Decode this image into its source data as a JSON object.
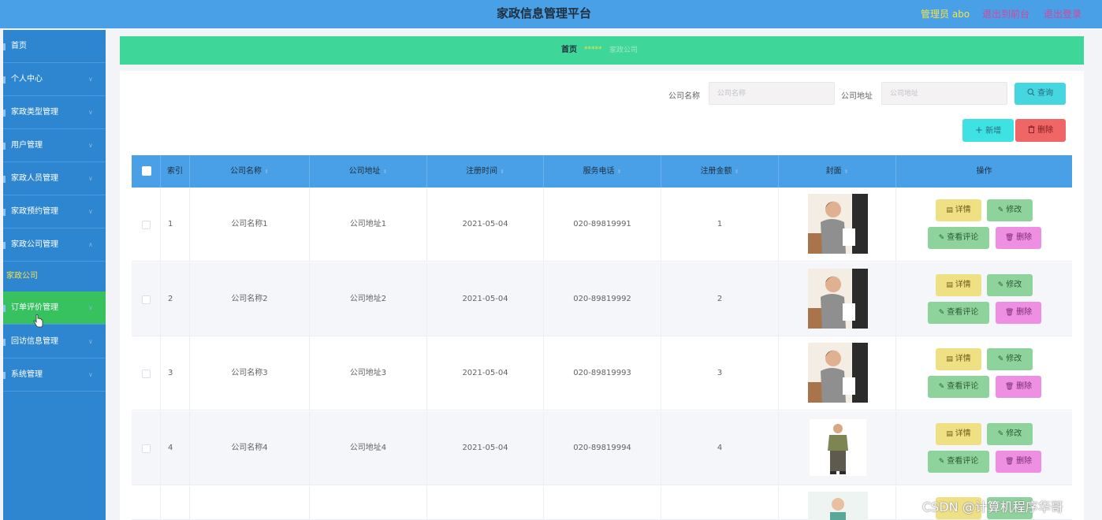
{
  "header": {
    "title": "家政信息管理平台",
    "admin": "管理员 abo",
    "front_link": "退出到前台",
    "logout_link": "退出登录"
  },
  "sidebar": {
    "items": [
      {
        "label": "首页"
      },
      {
        "label": "个人中心"
      },
      {
        "label": "家政类型管理"
      },
      {
        "label": "用户管理"
      },
      {
        "label": "家政人员管理"
      },
      {
        "label": "家政预约管理"
      },
      {
        "label": "家政公司管理"
      },
      {
        "label": "订单评价管理"
      },
      {
        "label": "回访信息管理"
      },
      {
        "label": "系统管理"
      }
    ],
    "subitem": "家政公司",
    "chevron_down": "∨",
    "chevron_up": "∧"
  },
  "breadcrumb": {
    "home": "首页",
    "separator": "*****",
    "current": "家政公司"
  },
  "search": {
    "name_label": "公司名称",
    "name_placeholder": "公司名称",
    "address_label": "公司地址",
    "address_placeholder": "公司地址",
    "query_label": "查询",
    "query_icon": "search-icon"
  },
  "toolbar": {
    "add_label": "新增",
    "delete_label": "删除"
  },
  "table": {
    "columns": [
      "索引",
      "公司名称",
      "公司地址",
      "注册时间",
      "服务电话",
      "注册金额",
      "封面",
      "操作"
    ],
    "sort_glyph": "⬍",
    "rows": [
      {
        "index": "1",
        "name": "公司名称1",
        "address": "公司地址1",
        "date": "2021-05-04",
        "phone": "020-89819991",
        "amount": "1",
        "cover": "photo-woman"
      },
      {
        "index": "2",
        "name": "公司名称2",
        "address": "公司地址2",
        "date": "2021-05-04",
        "phone": "020-89819992",
        "amount": "2",
        "cover": "photo-woman"
      },
      {
        "index": "3",
        "name": "公司名称3",
        "address": "公司地址3",
        "date": "2021-05-04",
        "phone": "020-89819993",
        "amount": "3",
        "cover": "photo-woman"
      },
      {
        "index": "4",
        "name": "公司名称4",
        "address": "公司地址4",
        "date": "2021-05-04",
        "phone": "020-89819994",
        "amount": "4",
        "cover": "photo-man"
      }
    ],
    "actions": {
      "detail": "详情",
      "edit": "修改",
      "review": "查看评论",
      "delete": "删除"
    }
  },
  "watermark": "CSDN @计算机程序华哥",
  "colors": {
    "header": "#4aa0e6",
    "sidebar": "#2f86d0",
    "active_menu": "#37c15f",
    "breadcrumb": "#3fd69a",
    "table_header": "#4aa0e6"
  }
}
